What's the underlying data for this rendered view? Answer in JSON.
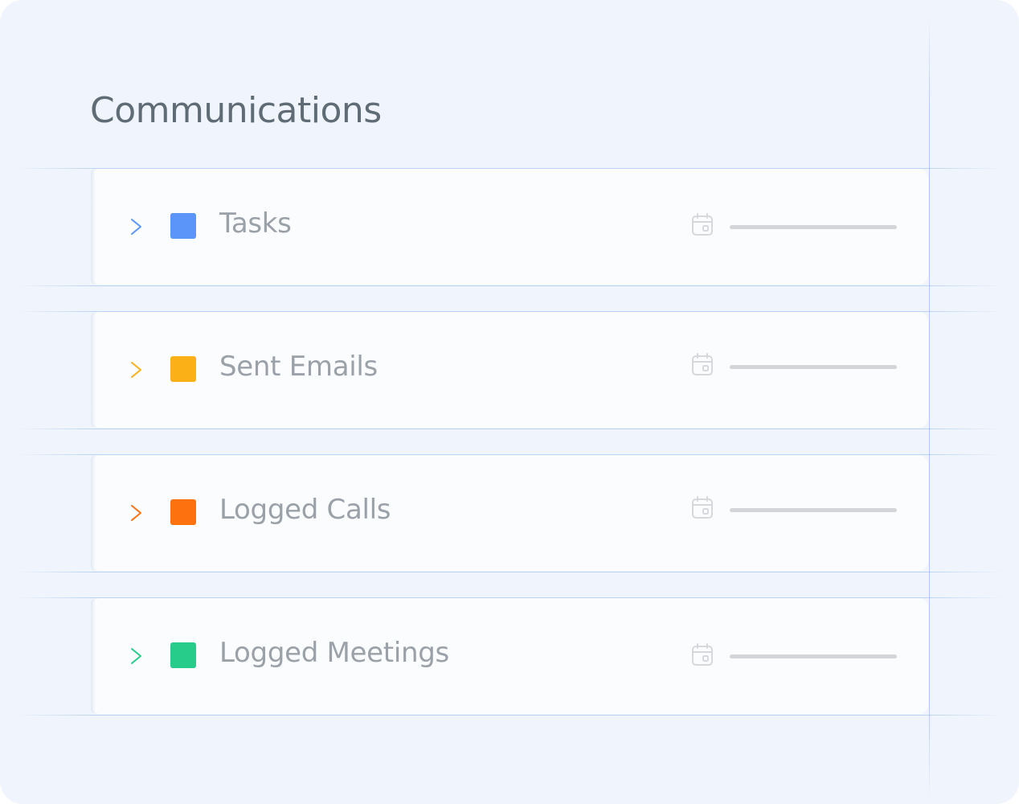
{
  "section": {
    "title": "Communications"
  },
  "rows": [
    {
      "label": "Tasks",
      "accent": "#5b95f9",
      "chevron_icon": "chevron-right-icon",
      "date_icon": "calendar-icon"
    },
    {
      "label": "Sent Emails",
      "accent": "#fbb017",
      "chevron_icon": "chevron-right-icon",
      "date_icon": "calendar-icon"
    },
    {
      "label": "Logged Calls",
      "accent": "#fd720f",
      "chevron_icon": "chevron-right-icon",
      "date_icon": "calendar-icon"
    },
    {
      "label": "Logged Meetings",
      "accent": "#27cb8a",
      "chevron_icon": "chevron-right-icon",
      "date_icon": "calendar-icon"
    }
  ],
  "colors": {
    "background": "#f0f5fd",
    "row_background": "#fbfcfe",
    "title_text": "#5f6b75",
    "label_text": "#9aa1a8",
    "placeholder_bar": "#d3d5d8",
    "guide_line": "#a9c8f0"
  }
}
